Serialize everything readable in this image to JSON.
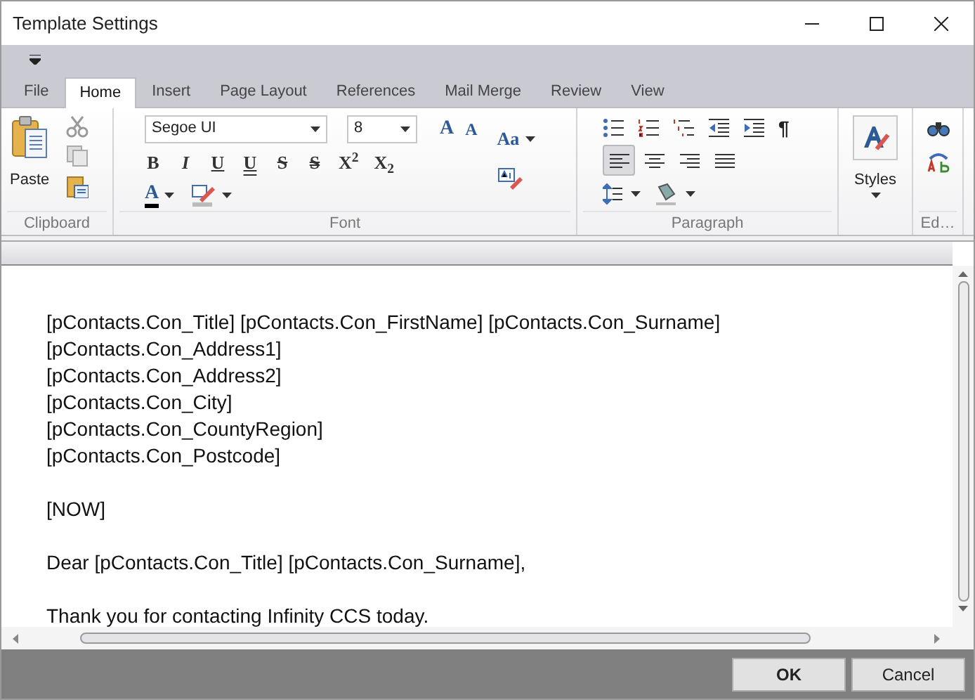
{
  "window": {
    "title": "Template Settings"
  },
  "tabs": [
    {
      "label": "File",
      "selected": false
    },
    {
      "label": "Home",
      "selected": true
    },
    {
      "label": "Insert",
      "selected": false
    },
    {
      "label": "Page Layout",
      "selected": false
    },
    {
      "label": "References",
      "selected": false
    },
    {
      "label": "Mail Merge",
      "selected": false
    },
    {
      "label": "Review",
      "selected": false
    },
    {
      "label": "View",
      "selected": false
    }
  ],
  "clipboard": {
    "paste": "Paste",
    "group": "Clipboard"
  },
  "font": {
    "group": "Font",
    "font_name": "Segoe UI",
    "font_size": "8",
    "grow": "A",
    "shrink": "A",
    "change_case": "Aa",
    "font_color": "A",
    "buttons": [
      {
        "kind": "bold",
        "label": "B"
      },
      {
        "kind": "italic",
        "label": "I"
      },
      {
        "kind": "underline",
        "label": "U"
      },
      {
        "kind": "double-underline",
        "label": "U"
      },
      {
        "kind": "strikethrough",
        "label": "S"
      },
      {
        "kind": "double-strikethrough",
        "label": "S"
      },
      {
        "kind": "superscript",
        "label": "X$^{2}$"
      },
      {
        "kind": "subscript",
        "label": "X$_{2}$"
      }
    ]
  },
  "paragraph": {
    "group": "Paragraph",
    "mark": "¶",
    "align": [
      {
        "kind": "left",
        "selected": true
      },
      {
        "kind": "center",
        "selected": false
      },
      {
        "kind": "right",
        "selected": false
      },
      {
        "kind": "justify",
        "selected": false
      }
    ]
  },
  "styles": {
    "label": "Styles"
  },
  "editing": {
    "group": "Ed…"
  },
  "document": {
    "paragraphs": [
      [
        "[pContacts.Con_Title] [pContacts.Con_FirstName] [pContacts.Con_Surname]",
        "[pContacts.Con_Address1]",
        "[pContacts.Con_Address2]",
        "[pContacts.Con_City]",
        "[pContacts.Con_CountyRegion]",
        "[pContacts.Con_Postcode]"
      ],
      [
        "[NOW]"
      ],
      [
        "Dear [pContacts.Con_Title] [pContacts.Con_Surname],"
      ],
      [
        "Thank you for contacting Infinity CCS today."
      ]
    ]
  },
  "buttons": [
    {
      "kind": "ok",
      "label": "OK"
    },
    {
      "kind": "cancel",
      "label": "Cancel"
    }
  ]
}
